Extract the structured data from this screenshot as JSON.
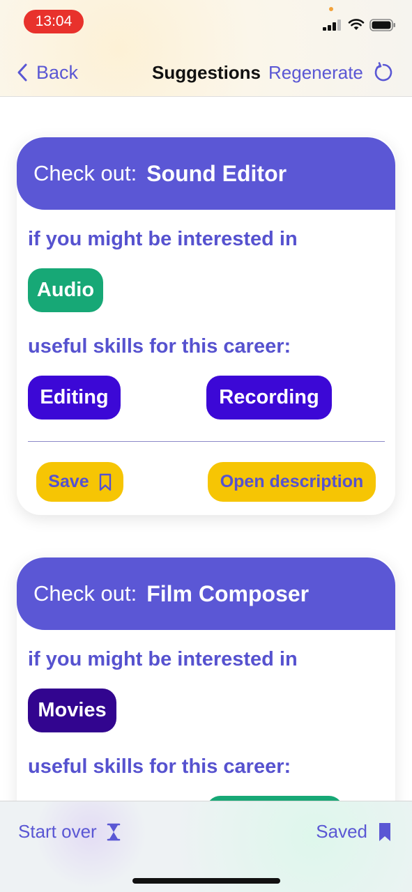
{
  "status_bar": {
    "time": "13:04"
  },
  "nav": {
    "back_label": "Back",
    "title": "Suggestions",
    "regenerate_label": "Regenerate"
  },
  "colors": {
    "accent": "#5a57d4",
    "header": "#5b57d5",
    "green_chip": "#17a876",
    "blue_chip": "#3c08d6",
    "navy_chip": "#32058f",
    "action": "#f6c504"
  },
  "cards": [
    {
      "prefix": "Check out:",
      "title": "Sound Editor",
      "interest_label": "if you might be interested in",
      "interests": [
        "Audio"
      ],
      "skills_label": "useful skills for this career:",
      "skills": [
        "Editing",
        "Recording"
      ],
      "save_label": "Save",
      "open_label": "Open description"
    },
    {
      "prefix": "Check out:",
      "title": "Film Composer",
      "interest_label": "if you might be interested in",
      "interests": [
        "Movies"
      ],
      "skills_label": "useful skills for this career:"
    }
  ],
  "bottom_bar": {
    "start_over_label": "Start over",
    "saved_label": "Saved"
  },
  "icons": [
    "chevron-left-icon",
    "refresh-icon",
    "bookmark-outline-icon",
    "hourglass-icon",
    "bookmark-filled-icon"
  ]
}
